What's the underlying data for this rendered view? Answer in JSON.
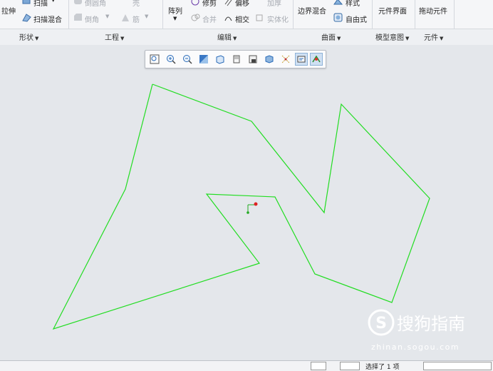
{
  "ribbon": {
    "shape_tools": {
      "extrude": "拉伸",
      "sweep": "扫描",
      "swept_blend": "扫描混合"
    },
    "engineering_tools": {
      "round": "倒圆角",
      "chamfer": "倒角",
      "rib": "筋",
      "shell": "壳"
    },
    "edit_tools": {
      "pattern": "阵列",
      "trim": "修剪",
      "offset": "偏移",
      "thicken": "加厚",
      "merge": "合并",
      "intersect": "相交",
      "solidify": "实体化"
    },
    "surface_tools": {
      "boundary_blend": "边界混合",
      "style": "样式",
      "freestyle": "自由式"
    },
    "model_intent_tools": {
      "component_interface": "元件界面"
    },
    "component_tools": {
      "drag_components": "拖动元件"
    },
    "groups": {
      "shapes": "形状",
      "engineering": "工程",
      "editing": "编辑",
      "surfaces": "曲面",
      "model_intent": "模型意图",
      "components": "元件"
    }
  },
  "view_toolbar": {
    "buttons": [
      "refit-icon",
      "zoom-in-icon",
      "zoom-out-icon",
      "repaint-icon",
      "display-style-icon",
      "saved-views-icon",
      "view-manager-icon",
      "datum-display-icon",
      "spin-center-icon",
      "annotation-display-icon"
    ]
  },
  "status_bar": {
    "selection_text": "选择了 1 项"
  },
  "watermark": {
    "brand": "搜狗指南",
    "url": "zhinan.sogou.com"
  },
  "colors": {
    "sketch_line": "#22dd22",
    "csys_red": "#dd2222",
    "background": "#e4e7eb"
  }
}
